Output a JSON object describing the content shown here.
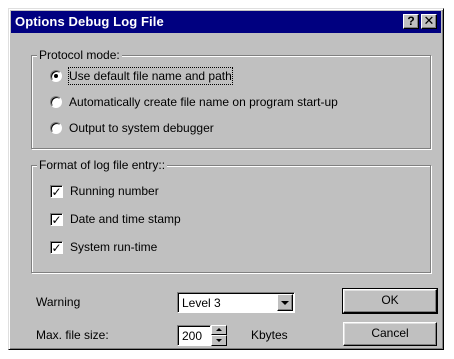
{
  "window": {
    "title": "Options Debug Log File",
    "help_glyph": "?",
    "close_glyph": "✕"
  },
  "protocol": {
    "legend": "Protocol mode:",
    "options": [
      {
        "label": "Use default file name and path",
        "selected": true
      },
      {
        "label": "Automatically create file name on program start-up",
        "selected": false
      },
      {
        "label": "Output to system debugger",
        "selected": false
      }
    ]
  },
  "format": {
    "legend": "Format of log file entry::",
    "options": [
      {
        "label": "Running number",
        "checked": true
      },
      {
        "label": "Date and time stamp",
        "checked": true
      },
      {
        "label": "System run-time",
        "checked": true
      }
    ],
    "check_glyph": "✓"
  },
  "warning": {
    "label": "Warning",
    "value": "Level 3"
  },
  "maxsize": {
    "label": "Max. file size:",
    "value": "200",
    "unit": "Kbytes"
  },
  "buttons": {
    "ok": "OK",
    "cancel": "Cancel"
  }
}
